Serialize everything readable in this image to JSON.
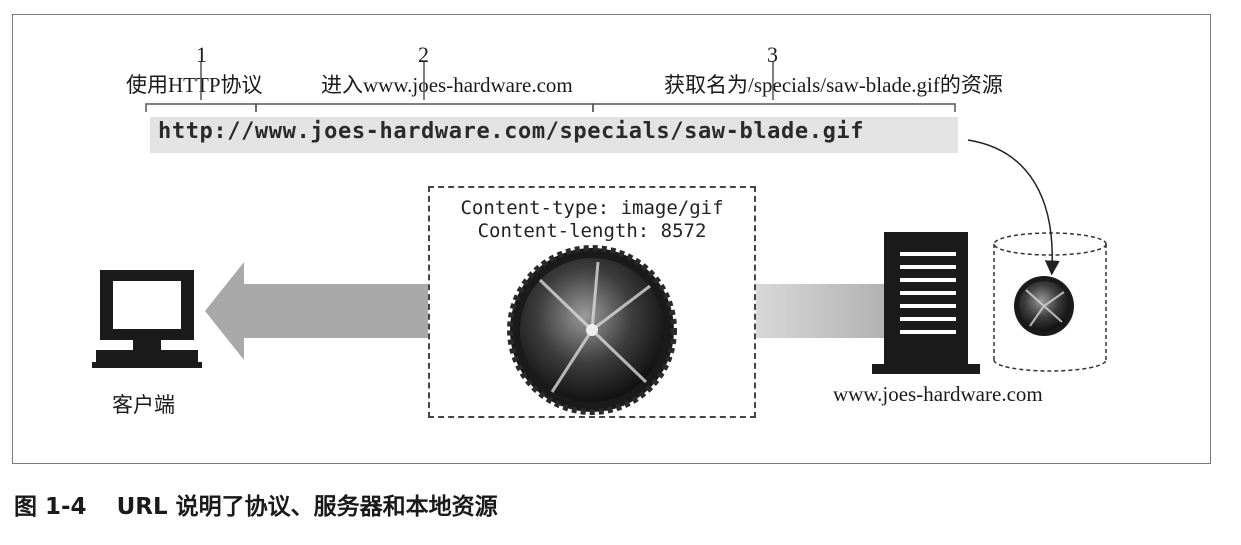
{
  "segments": [
    {
      "number": "1",
      "label": "使用HTTP协议"
    },
    {
      "number": "2",
      "label": "进入www.joes-hardware.com"
    },
    {
      "number": "3",
      "label": "获取名为/specials/saw-blade.gif的资源"
    }
  ],
  "url": "http://www.joes-hardware.com/specials/saw-blade.gif",
  "response_headers": [
    "Content-type: image/gif",
    "Content-length: 8572"
  ],
  "client_label": "客户端",
  "server_label": "www.joes-hardware.com",
  "figure": {
    "number": "图 1-4",
    "caption": "URL 说明了协议、服务器和本地资源"
  },
  "colors": {
    "arrow": "#a9a9a9",
    "url_band": "#e3e3e3",
    "ink": "#1a1a1a"
  }
}
